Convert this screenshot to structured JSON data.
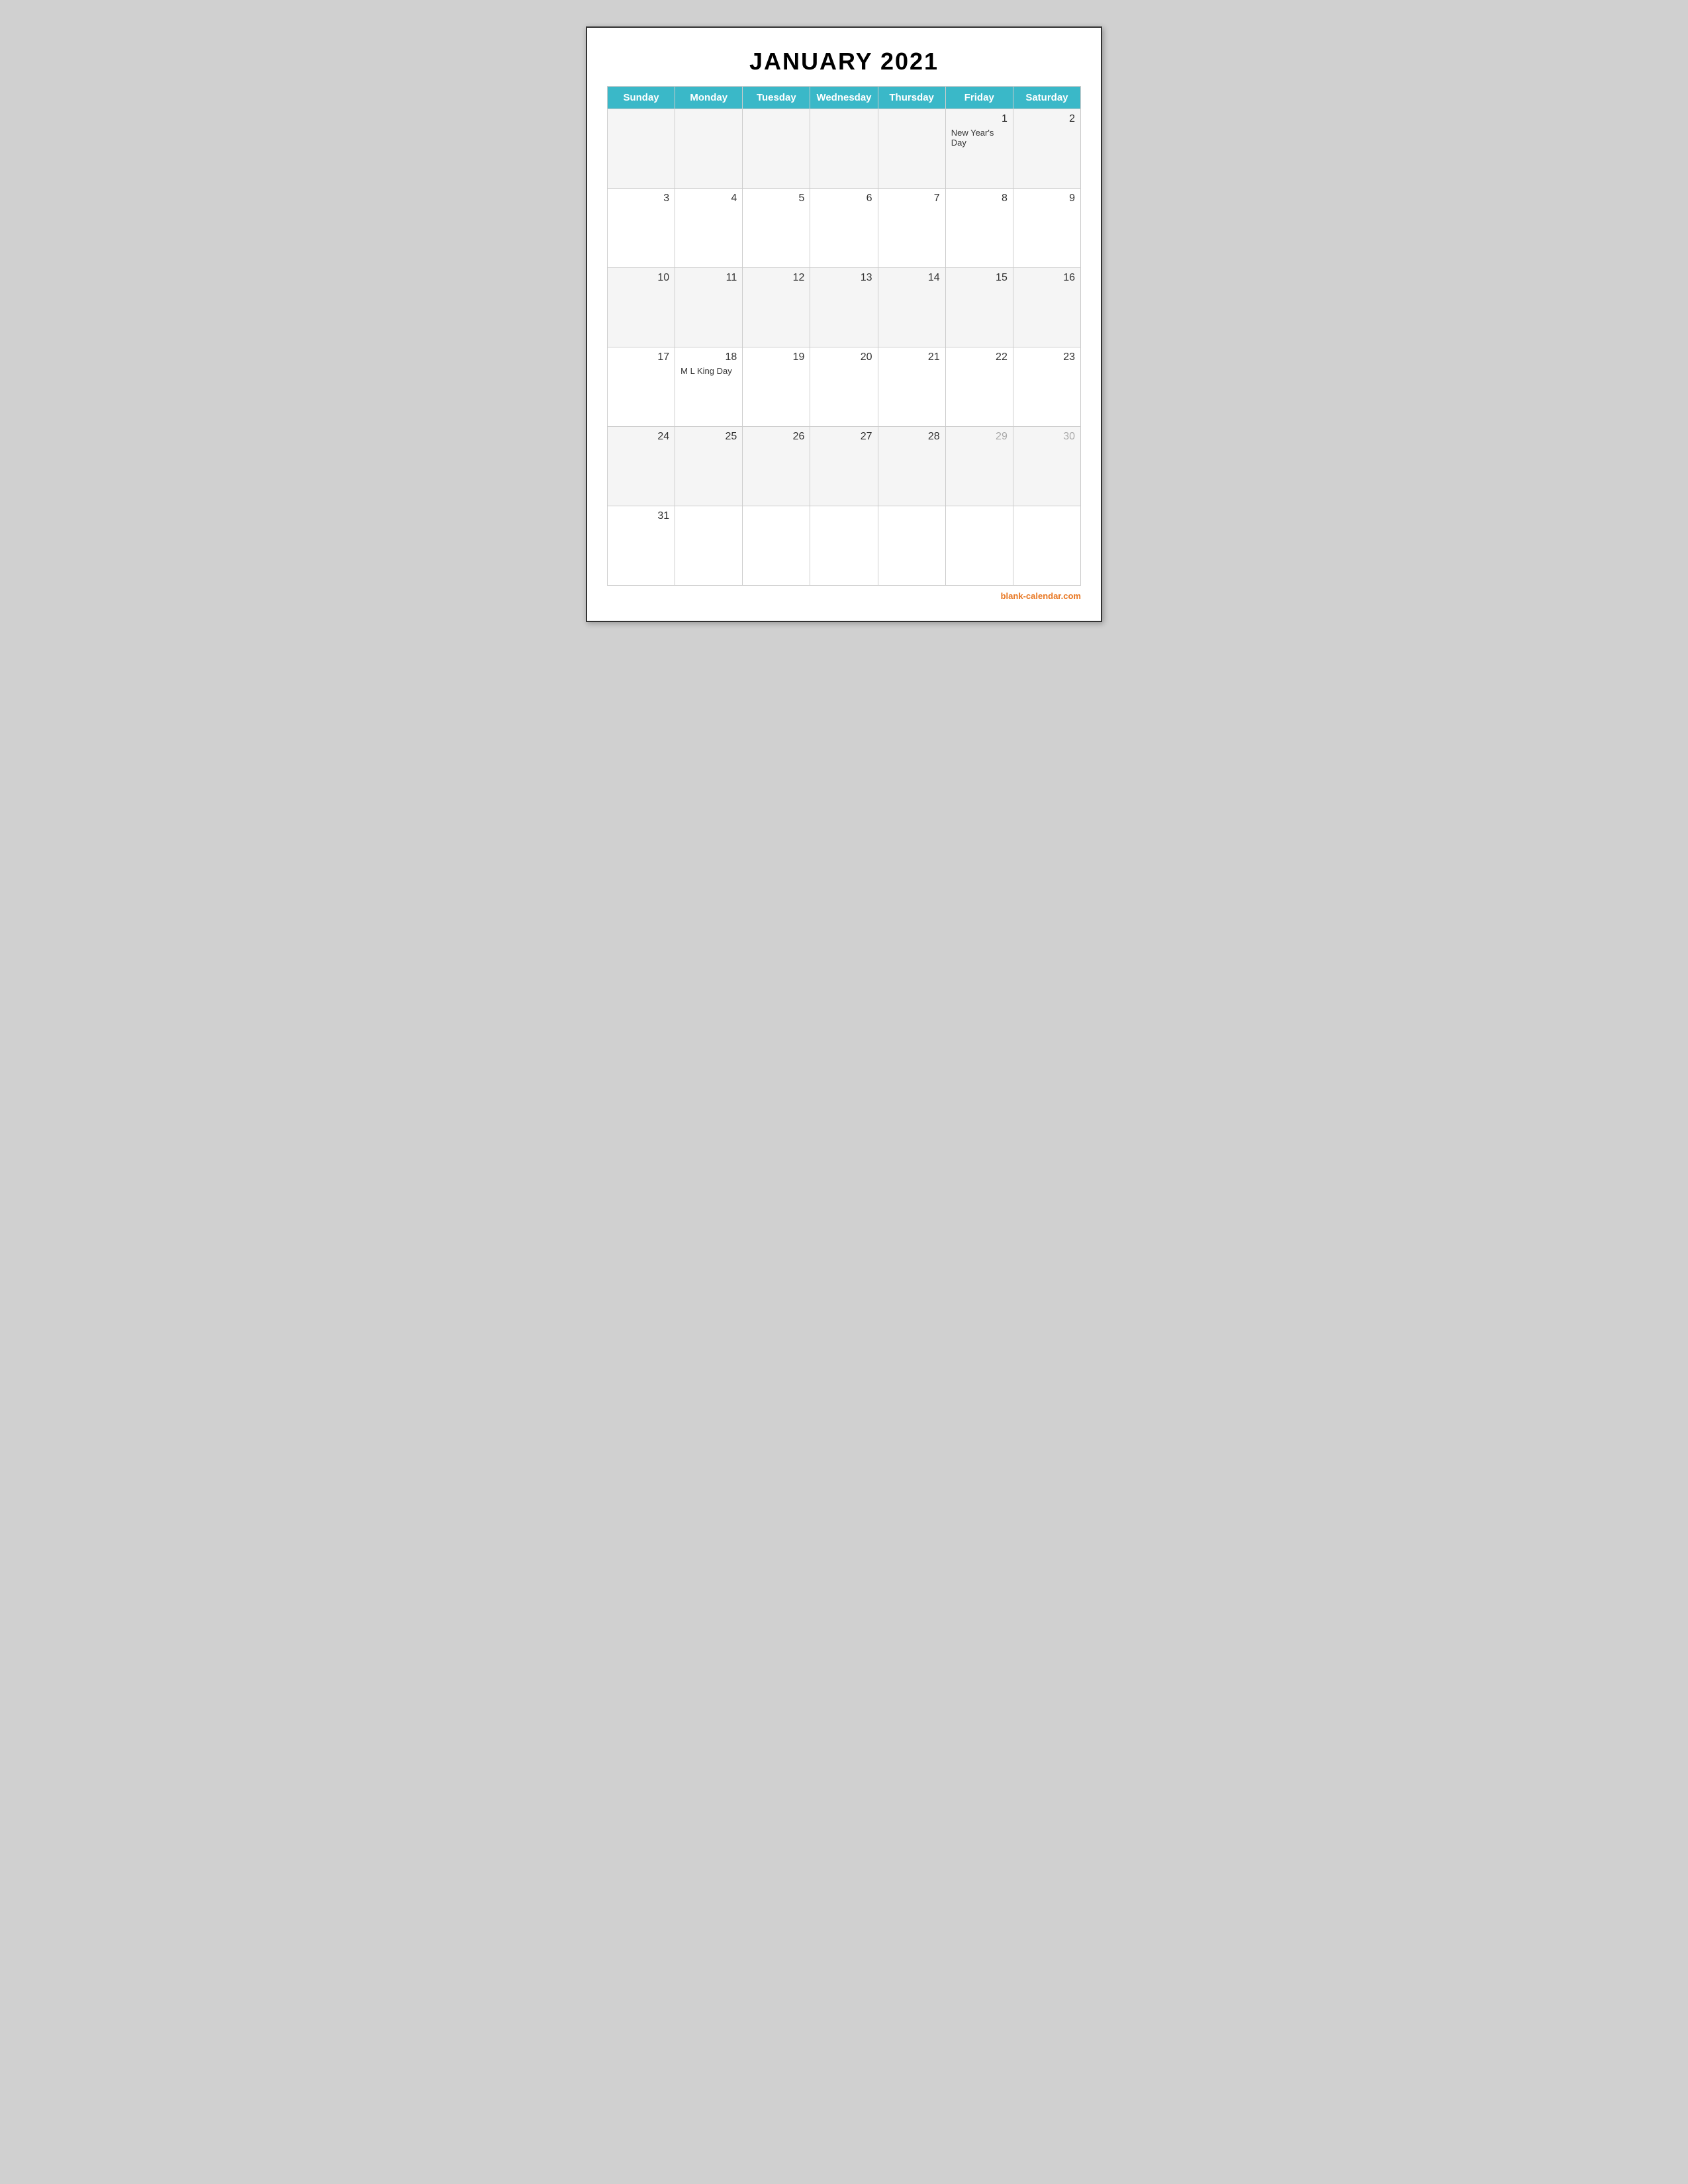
{
  "title": "JANUARY 2021",
  "days_of_week": [
    "Sunday",
    "Monday",
    "Tuesday",
    "Wednesday",
    "Thursday",
    "Friday",
    "Saturday"
  ],
  "weeks": [
    [
      {
        "day": "",
        "holiday": ""
      },
      {
        "day": "",
        "holiday": ""
      },
      {
        "day": "",
        "holiday": ""
      },
      {
        "day": "",
        "holiday": ""
      },
      {
        "day": "",
        "holiday": ""
      },
      {
        "day": "1",
        "holiday": "New Year's Day"
      },
      {
        "day": "2",
        "holiday": ""
      }
    ],
    [
      {
        "day": "3",
        "holiday": ""
      },
      {
        "day": "4",
        "holiday": ""
      },
      {
        "day": "5",
        "holiday": ""
      },
      {
        "day": "6",
        "holiday": ""
      },
      {
        "day": "7",
        "holiday": ""
      },
      {
        "day": "8",
        "holiday": ""
      },
      {
        "day": "9",
        "holiday": ""
      }
    ],
    [
      {
        "day": "10",
        "holiday": ""
      },
      {
        "day": "11",
        "holiday": ""
      },
      {
        "day": "12",
        "holiday": ""
      },
      {
        "day": "13",
        "holiday": ""
      },
      {
        "day": "14",
        "holiday": ""
      },
      {
        "day": "15",
        "holiday": ""
      },
      {
        "day": "16",
        "holiday": ""
      }
    ],
    [
      {
        "day": "17",
        "holiday": ""
      },
      {
        "day": "18",
        "holiday": "M L King Day"
      },
      {
        "day": "19",
        "holiday": ""
      },
      {
        "day": "20",
        "holiday": ""
      },
      {
        "day": "21",
        "holiday": ""
      },
      {
        "day": "22",
        "holiday": ""
      },
      {
        "day": "23",
        "holiday": ""
      }
    ],
    [
      {
        "day": "24",
        "holiday": ""
      },
      {
        "day": "25",
        "holiday": ""
      },
      {
        "day": "26",
        "holiday": ""
      },
      {
        "day": "27",
        "holiday": ""
      },
      {
        "day": "28",
        "holiday": ""
      },
      {
        "day": "29",
        "holiday": "",
        "greyed": true
      },
      {
        "day": "30",
        "holiday": "",
        "greyed": true
      }
    ],
    [
      {
        "day": "31",
        "holiday": ""
      },
      {
        "day": "",
        "holiday": ""
      },
      {
        "day": "",
        "holiday": ""
      },
      {
        "day": "",
        "holiday": ""
      },
      {
        "day": "",
        "holiday": ""
      },
      {
        "day": "",
        "holiday": ""
      },
      {
        "day": "",
        "holiday": ""
      }
    ]
  ],
  "footer": {
    "text": "blank-calendar.com",
    "color": "#e87722"
  }
}
